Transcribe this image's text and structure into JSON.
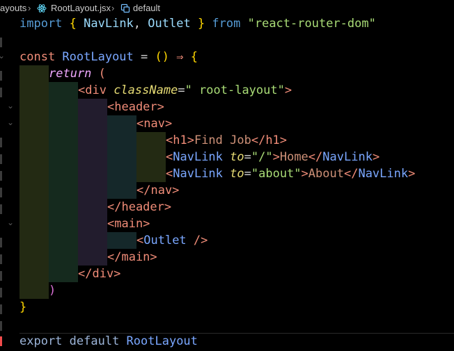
{
  "breadcrumb": {
    "folder": "ayouts",
    "file": "RootLayout.jsx",
    "symbol": "default",
    "sep1": "›",
    "sep2": "›"
  },
  "code": {
    "l1_import": "import",
    "l1_open": " { ",
    "l1_a": "NavLink",
    "l1_comma": ", ",
    "l1_b": "Outlet",
    "l1_close": " } ",
    "l1_from": "from ",
    "l1_src": "\"react-router-dom\"",
    "l3_const": "const ",
    "l3_name": "RootLayout",
    "l3_eq": " = ",
    "l3_paren": "()",
    "l3_arrow": " ⇒ ",
    "l3_brace": "{",
    "l4_return": "return",
    "l4_paren": " (",
    "l5_open": "<div ",
    "l5_attr": "className",
    "l5_eq": "=",
    "l5_val": "\" root-layout\"",
    "l5_close": ">",
    "l6": "<header>",
    "l7": "<nav>",
    "l8_open": "<h1>",
    "l8_text": "Find Job",
    "l8_close": "</h1>",
    "l9_lt": "<",
    "l9_comp": "NavLink",
    "l9_attr": " to",
    "l9_eq": "=",
    "l9_val": "\"/\"",
    "l9_gt": ">",
    "l9_text": "Home",
    "l9_close_lt": "</",
    "l9_close_comp": "NavLink",
    "l9_close_gt": ">",
    "l10_lt": "<",
    "l10_comp": "NavLink",
    "l10_attr": " to",
    "l10_eq": "=",
    "l10_val": "\"about\"",
    "l10_gt": ">",
    "l10_text": "About",
    "l10_close_lt": "</",
    "l10_close_comp": "NavLink",
    "l10_close_gt": ">",
    "l11": "</nav>",
    "l12": "</header>",
    "l13": "<main>",
    "l14_lt": "<",
    "l14_comp": "Outlet",
    "l14_end": " />",
    "l15": "</main>",
    "l16": "</div>",
    "l17": ")",
    "l18": "}",
    "l20_export": "export ",
    "l20_default": "default ",
    "l20_name": "RootLayout"
  },
  "colors": {
    "keyword": "#569cd6",
    "control": "#c586c0",
    "function": "#dcdcaa",
    "component": "#4ec9b0",
    "string": "#ce9178",
    "tag": "#f08c78",
    "bracket1": "#ffd700",
    "bracket2": "#da70d6"
  },
  "icons": [
    "react-file-icon",
    "symbol-icon",
    "chevron-down-icon"
  ]
}
